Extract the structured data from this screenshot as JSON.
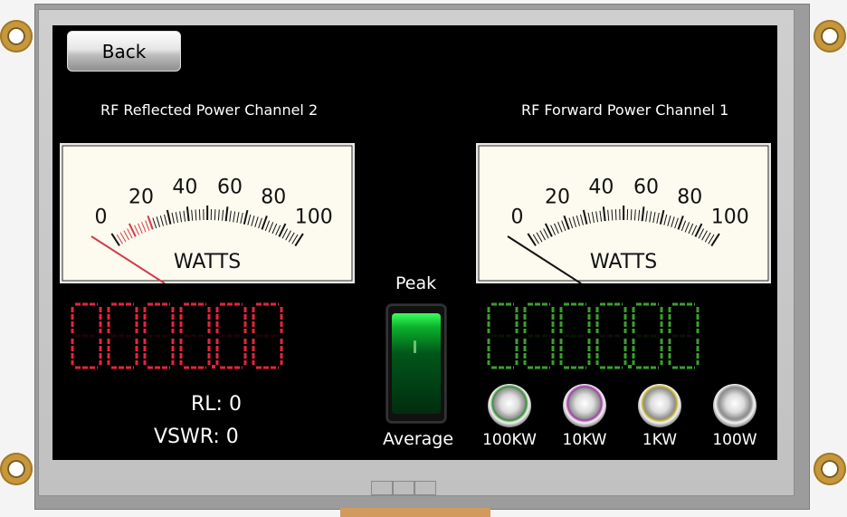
{
  "colors": {
    "screen": "#000000",
    "reflected_digits": "#e8243c",
    "forward_digits": "#3aa02d",
    "meter_face": "#fdfbef"
  },
  "toolbar": {
    "back_label": "Back"
  },
  "channels": {
    "reflected": {
      "title": "RF Reflected Power Channel 2",
      "unit": "WATTS",
      "scale": [
        "0",
        "20",
        "40",
        "60",
        "80",
        "100"
      ],
      "value": 0,
      "display": "0000.00"
    },
    "forward": {
      "title": "RF Forward Power Channel 1",
      "unit": "WATTS",
      "scale": [
        "0",
        "20",
        "40",
        "60",
        "80",
        "100"
      ],
      "value": 0,
      "display": "0000.00"
    }
  },
  "stats": {
    "rl": "RL: 0",
    "vswr": "VSWR: 0"
  },
  "mode_switch": {
    "top_label": "Peak",
    "bottom_label": "Average",
    "state": "peak"
  },
  "range_buttons": [
    {
      "label": "100KW",
      "ring": "#2f8f2f"
    },
    {
      "label": "10KW",
      "ring": "#a235a8"
    },
    {
      "label": "1KW",
      "ring": "#b9a929"
    },
    {
      "label": "100W",
      "ring": "#9a9a9a"
    }
  ]
}
